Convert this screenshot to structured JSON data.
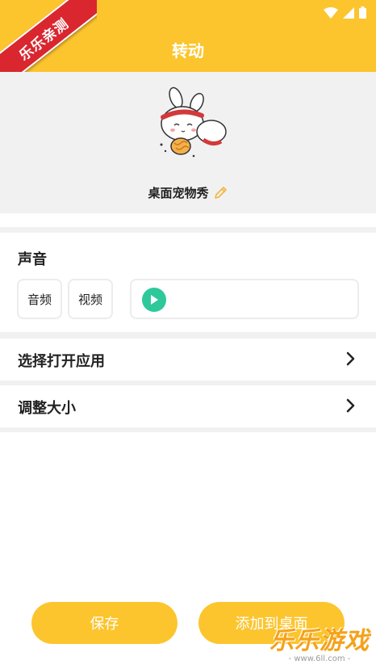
{
  "header": {
    "title": "转动"
  },
  "ribbon": {
    "text": "乐乐亲测"
  },
  "pet": {
    "name": "桌面宠物秀"
  },
  "sound": {
    "title": "声音",
    "audio_label": "音频",
    "video_label": "视频"
  },
  "rows": {
    "open_app": "选择打开应用",
    "resize": "调整大小"
  },
  "buttons": {
    "save": "保存",
    "add_to_desktop": "添加到桌面"
  },
  "watermark": {
    "brand": "乐乐游戏",
    "url": "- www.6ll.com -"
  },
  "colors": {
    "accent": "#fcc52e",
    "play": "#2ec99a",
    "ribbon": "#d9262f",
    "section_bg": "#f1f1f2"
  },
  "icons": [
    "back-arrow-icon",
    "wifi-icon",
    "signal-icon",
    "battery-icon",
    "edit-pencil-icon",
    "play-icon",
    "chevron-right-icon"
  ]
}
